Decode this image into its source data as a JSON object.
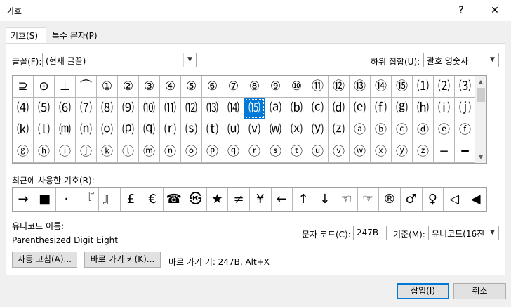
{
  "window": {
    "title": "기호",
    "help_label": "?",
    "close_label": "✕"
  },
  "tabs": [
    {
      "label": "기호(S)"
    },
    {
      "label": "특수 문자(P)"
    }
  ],
  "font": {
    "label": "글꼴(F):",
    "value": "(현재 글꼴)"
  },
  "subset": {
    "label": "하위 집합(U):",
    "value": "괄호 영숫자"
  },
  "grid": {
    "selected_index": 33,
    "cells": [
      "⊇",
      "⊙",
      "⊥",
      "⌒",
      "①",
      "②",
      "③",
      "④",
      "⑤",
      "⑥",
      "⑦",
      "⑧",
      "⑨",
      "⑩",
      "⑪",
      "⑫",
      "⑬",
      "⑭",
      "⑮",
      "⑴",
      "⑵",
      "⑶",
      "⑷",
      "⑸",
      "⑹",
      "⑺",
      "⑻",
      "⑼",
      "⑽",
      "⑾",
      "⑿",
      "⒀",
      "⒁",
      "⒂",
      "⒜",
      "⒝",
      "⒞",
      "⒟",
      "⒠",
      "⒡",
      "⒢",
      "⒣",
      "⒤",
      "⒥",
      "⒦",
      "⒧",
      "⒨",
      "⒩",
      "⒪",
      "⒫",
      "⒬",
      "⒭",
      "⒮",
      "⒯",
      "⒰",
      "⒱",
      "⒲",
      "⒳",
      "⒴",
      "⒵",
      "ⓐ",
      "ⓑ",
      "ⓒ",
      "ⓓ",
      "ⓔ",
      "ⓕ",
      "ⓖ",
      "ⓗ",
      "ⓘ",
      "ⓙ",
      "ⓚ",
      "ⓛ",
      "ⓜ",
      "ⓝ",
      "ⓞ",
      "ⓟ",
      "ⓠ",
      "ⓡ",
      "ⓢ",
      "ⓣ",
      "ⓤ",
      "ⓥ",
      "ⓦ",
      "ⓧ",
      "ⓨ",
      "ⓩ",
      "─",
      "━"
    ]
  },
  "recent": {
    "label": "최근에 사용한 기호(R):",
    "symbols": [
      "→",
      "■",
      "·",
      "『",
      "』",
      "£",
      "€",
      "☎",
      "㉿",
      "★",
      "≠",
      "¥",
      "←",
      "↑",
      "↓",
      "☜",
      "☞",
      "®",
      "♂",
      "♀",
      "◁",
      "◀"
    ]
  },
  "unicode_name": {
    "label": "유니코드 이름:",
    "value": "Parenthesized Digit Eight"
  },
  "char_code": {
    "label": "문자 코드(C):",
    "value": "247B"
  },
  "basis": {
    "label": "기준(M):",
    "value": "유니코드(16진"
  },
  "buttons": {
    "autocorrect": "자동 고침(A)...",
    "shortcut_key": "바로 가기 키(K)...",
    "insert": "삽입(I)",
    "cancel": "취소"
  },
  "shortcut_text": "바로 가기 키: 247B, Alt+X",
  "colors": {
    "selection": "#0078d7"
  }
}
